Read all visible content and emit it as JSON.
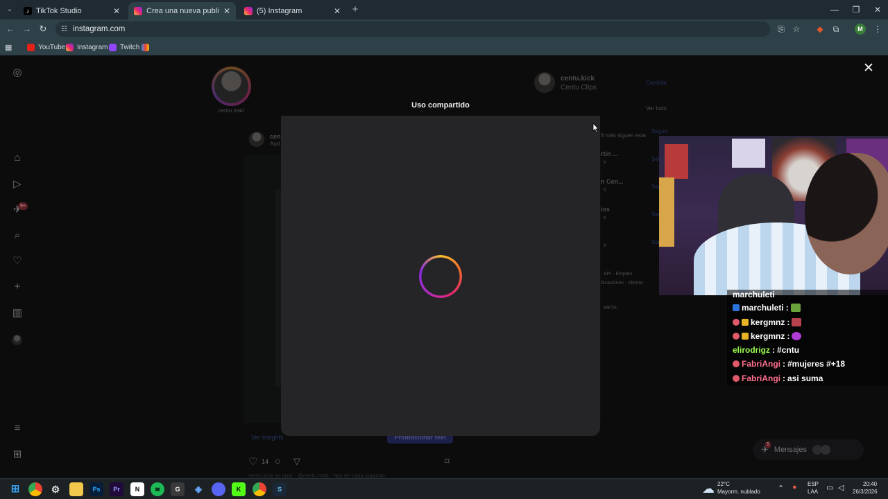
{
  "browser": {
    "tabs": [
      {
        "title": "TikTok Studio",
        "active": false
      },
      {
        "title": "Crea una nueva publicación • In",
        "active": true
      },
      {
        "title": "(5) Instagram",
        "active": false
      }
    ],
    "url": "instagram.com",
    "bookmarks": [
      "YouTube",
      "Instagram",
      "Twitch"
    ],
    "profile_initial": "M"
  },
  "instagram": {
    "story_username": "centu.mati",
    "suggest_user": "centu.kick",
    "suggest_sub": "Centu Clips",
    "cambiar": "Cambiar",
    "ver_todo": "Ver todo",
    "seguir": "Seguir",
    "post_user": "cen",
    "post_sub": "Aud",
    "followers_hint": "8 más siguen esta",
    "suggest_rows": [
      "rtin ...",
      "n Cen...",
      "ios"
    ],
    "suggest_rows_sub": [
      "ti",
      "ti",
      "ti"
    ],
    "footer_1": "· API · Empleo ·",
    "footer_2": "bicaciones · Idioma ·",
    "footer_3": "META",
    "ver_insights": "Ver insights",
    "promocionar": "Promocionar reel",
    "likes": "14",
    "caption": "centu.kick se unió · @centu.mati · hoy en casa jugando",
    "messages_label": "Mensajes",
    "notif_badge": "9+",
    "msg_badge": "5"
  },
  "modal": {
    "title": "Uso compartido"
  },
  "chat": [
    {
      "user": "marchuleti",
      "text": "",
      "color": "#ffffff"
    },
    {
      "user": "kergmnz",
      "text": "",
      "color": "#ffffff"
    },
    {
      "user": "kergmnz",
      "text": "",
      "color": "#ffffff"
    },
    {
      "user": "elirodrigz",
      "text": "#cntu",
      "color": "#9cff4f"
    },
    {
      "user": "FabriAngi",
      "text": "#mujeres #+18",
      "color": "#ff6f8d"
    },
    {
      "user": "FabriAngi",
      "text": "asi suma",
      "color": "#ff6f8d"
    }
  ],
  "taskbar": {
    "weather_temp": "22°C",
    "weather_desc": "Mayorm. nublado",
    "lang_1": "ESP",
    "lang_2": "LAA",
    "time": "20:40",
    "date": "26/3/2026"
  },
  "colors": {
    "accent_purple": "#4b4fd6",
    "spinner": [
      "#f9c12e",
      "#e8266e",
      "#8a2be2"
    ]
  }
}
